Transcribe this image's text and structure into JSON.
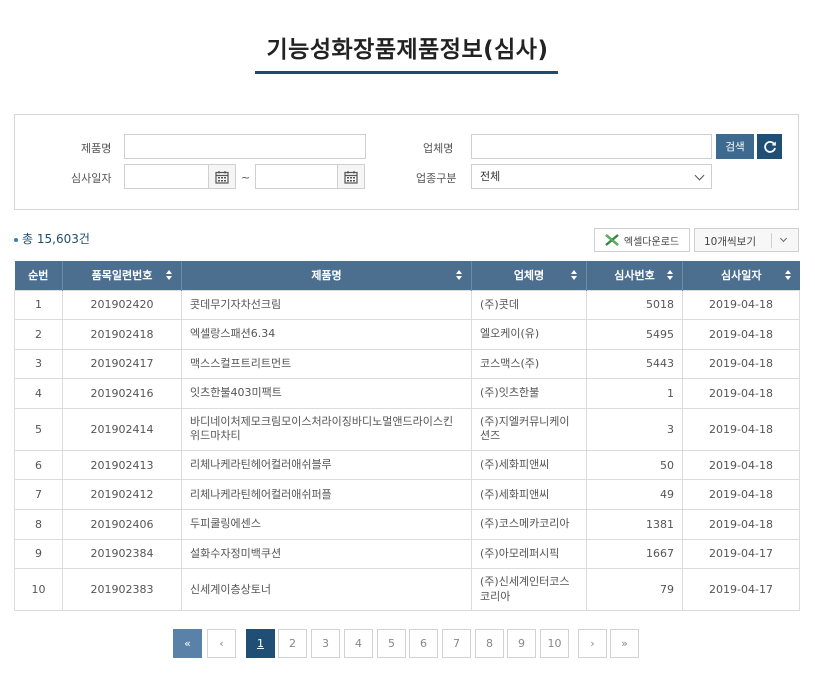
{
  "title": "기능성화장품제품정보(심사)",
  "search": {
    "product_label": "제품명",
    "product_value": "",
    "company_label": "업체명",
    "company_value": "",
    "date_label": "심사일자",
    "date_from": "",
    "date_sep": "~",
    "date_to": "",
    "category_label": "업종구분",
    "category_value": "전체",
    "search_button": "검색"
  },
  "total_text": "총 15,603건",
  "toolbar": {
    "excel_label": "엑셀다운로드",
    "perpage_label": "10개씩보기"
  },
  "table": {
    "headers": [
      "순번",
      "품목일련번호",
      "제품명",
      "업체명",
      "심사번호",
      "심사일자"
    ],
    "rows": [
      {
        "no": "1",
        "serial": "201902420",
        "product": "콧데무기자차선크림",
        "company": "(주)콧데",
        "review_no": "5018",
        "date": "2019-04-18"
      },
      {
        "no": "2",
        "serial": "201902418",
        "product": "엑셀랑스패션6.34",
        "company": "엘오케이(유)",
        "review_no": "5495",
        "date": "2019-04-18"
      },
      {
        "no": "3",
        "serial": "201902417",
        "product": "맥스스컬프트리트먼트",
        "company": "코스맥스(주)",
        "review_no": "5443",
        "date": "2019-04-18"
      },
      {
        "no": "4",
        "serial": "201902416",
        "product": "잇츠한불403미팩트",
        "company": "(주)잇츠한불",
        "review_no": "1",
        "date": "2019-04-18"
      },
      {
        "no": "5",
        "serial": "201902414",
        "product": "바디네이처제모크림모이스처라이징바디노멀앤드라이스킨위드마차티",
        "company": "(주)지엘커뮤니케이션즈",
        "review_no": "3",
        "date": "2019-04-18"
      },
      {
        "no": "6",
        "serial": "201902413",
        "product": "리체나케라틴헤어컬러애쉬블루",
        "company": "(주)세화피앤씨",
        "review_no": "50",
        "date": "2019-04-18"
      },
      {
        "no": "7",
        "serial": "201902412",
        "product": "리체나케라틴헤어컬러애쉬퍼플",
        "company": "(주)세화피앤씨",
        "review_no": "49",
        "date": "2019-04-18"
      },
      {
        "no": "8",
        "serial": "201902406",
        "product": "두피쿨링에센스",
        "company": "(주)코스메카코리아",
        "review_no": "1381",
        "date": "2019-04-18"
      },
      {
        "no": "9",
        "serial": "201902384",
        "product": "설화수자정미백쿠션",
        "company": "(주)아모레퍼시픽",
        "review_no": "1667",
        "date": "2019-04-17"
      },
      {
        "no": "10",
        "serial": "201902383",
        "product": "신세계이층상토너",
        "company": "(주)신세계인터코스코리아",
        "review_no": "79",
        "date": "2019-04-17"
      }
    ]
  },
  "pagination": {
    "first": "«",
    "prev": "‹",
    "pages": [
      "1",
      "2",
      "3",
      "4",
      "5",
      "6",
      "7",
      "8",
      "9",
      "10"
    ],
    "current": "1",
    "next": "›",
    "last": "»"
  },
  "colors": {
    "header_bg": "#4d6f8f",
    "accent": "#1f4f75",
    "link": "#2a72b8"
  }
}
